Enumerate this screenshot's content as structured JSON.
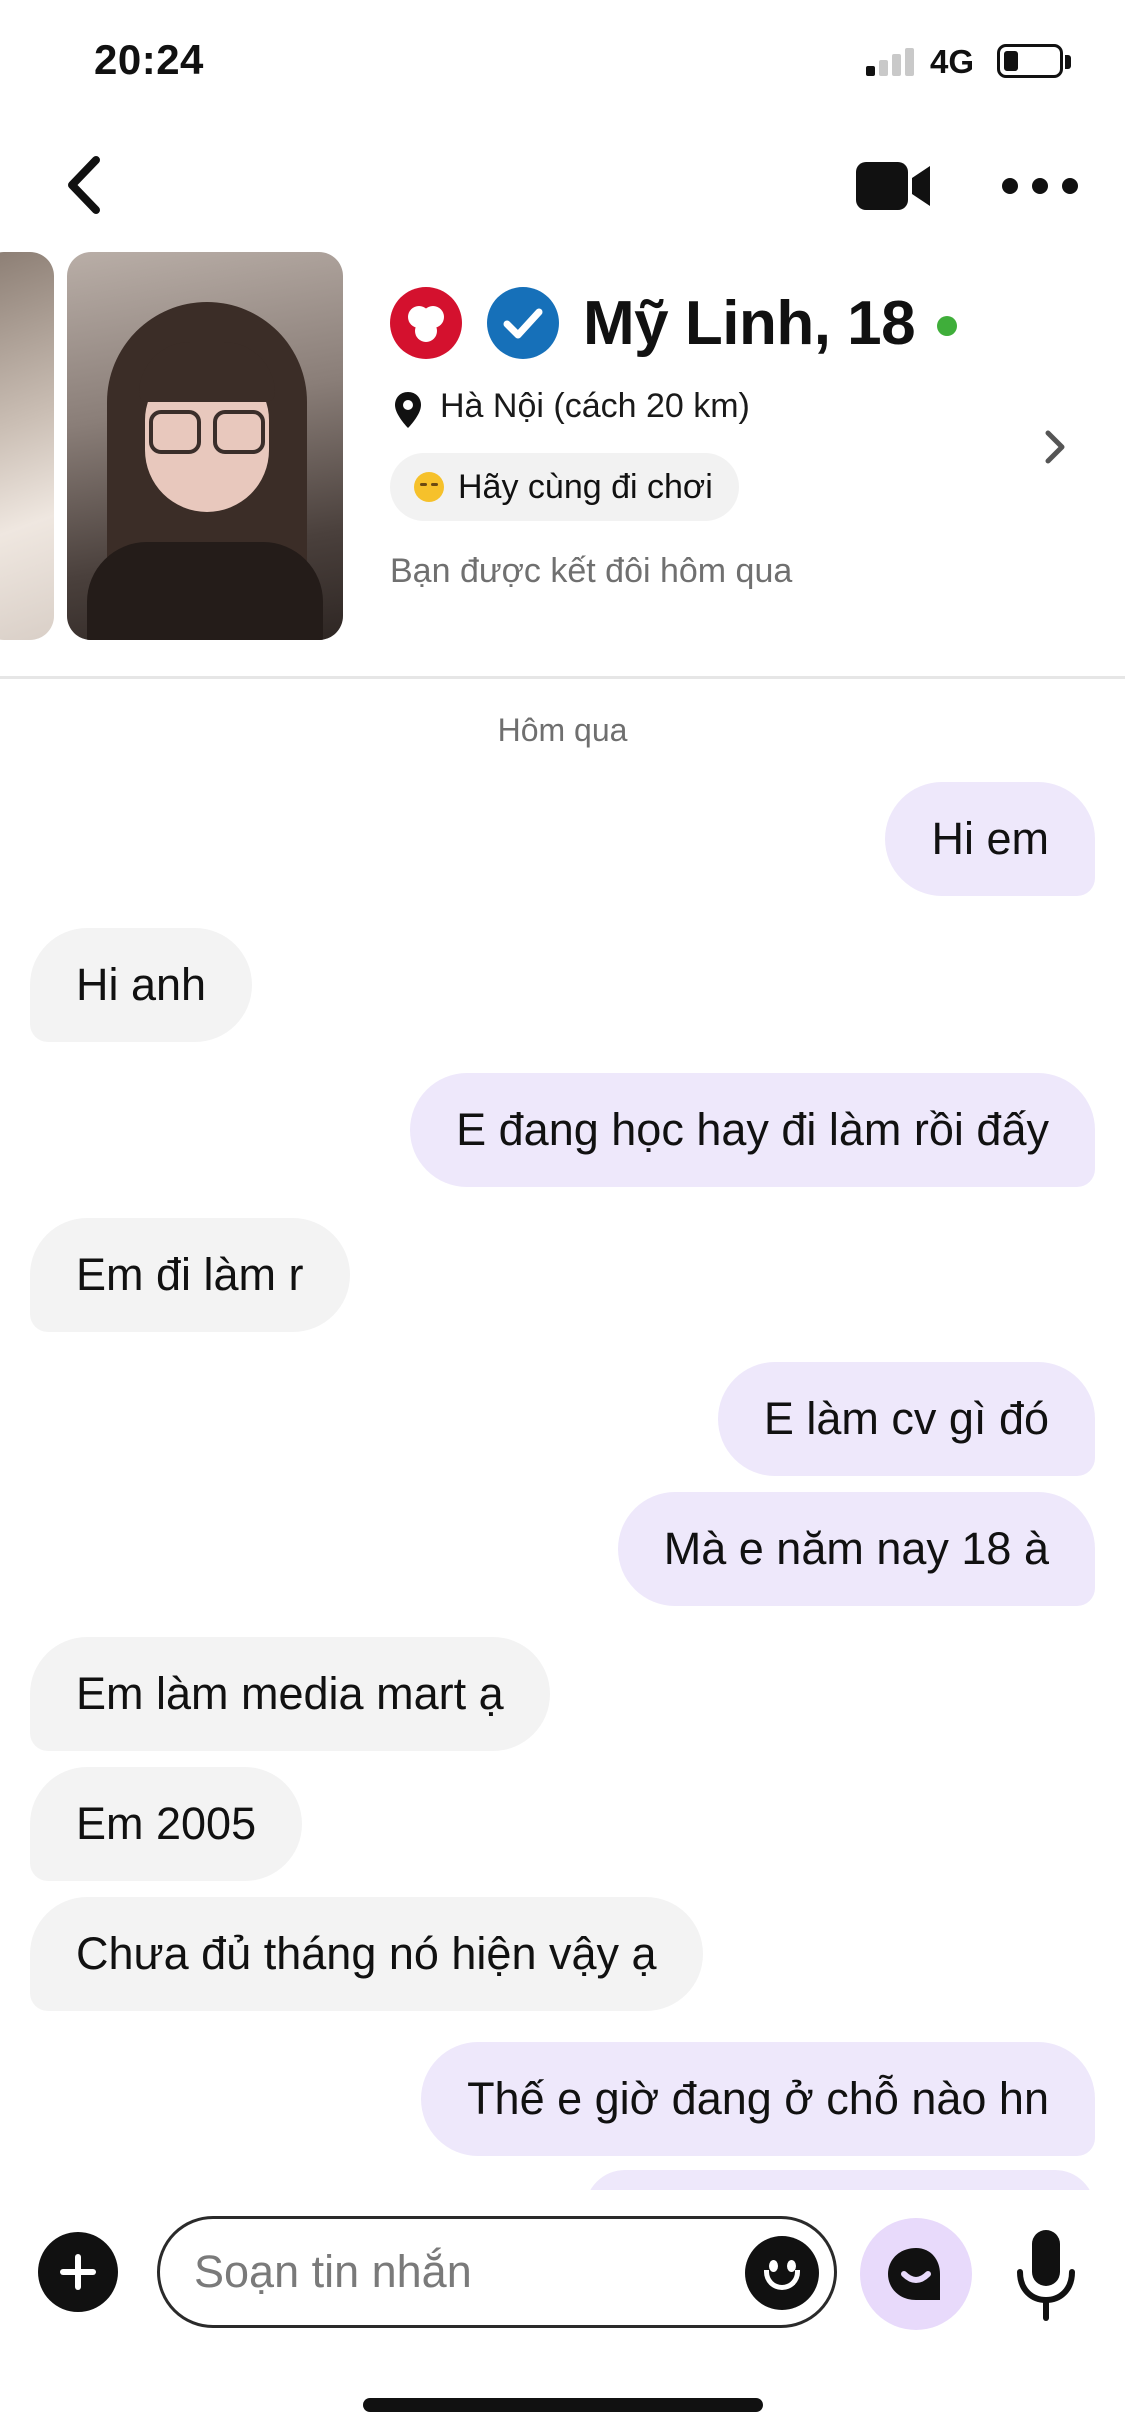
{
  "status_bar": {
    "time": "20:24",
    "network": "4G",
    "signal_bars_active": 1,
    "battery_level": 0.25
  },
  "nav": {
    "back_icon": "chevron-left-icon",
    "video_icon": "video-camera-icon",
    "more_icon": "more-horizontal-icon"
  },
  "profile": {
    "name": "Mỹ Linh, 18",
    "online": true,
    "location": "Hà Nội (cách 20 km)",
    "status_pill": "Hãy cùng đi chơi",
    "status_emoji": "relieved-face-emoji",
    "match_note": "Bạn được kết đôi hôm qua",
    "badges": [
      "bumble-badge-icon",
      "verified-badge-icon"
    ]
  },
  "chat": {
    "date_label": "Hôm qua",
    "messages": [
      {
        "from": "me",
        "text": "Hi em"
      },
      {
        "from": "them",
        "text": "Hi anh"
      },
      {
        "from": "me",
        "text": "E đang học hay đi làm rồi đấy"
      },
      {
        "from": "them",
        "text": "Em đi làm r"
      },
      {
        "from": "me",
        "text": "E làm cv gì đó"
      },
      {
        "from": "me",
        "text": "Mà e năm nay 18 à"
      },
      {
        "from": "them",
        "text": "Em làm media mart ạ"
      },
      {
        "from": "them",
        "text": "Em 2005"
      },
      {
        "from": "them",
        "text": "Chưa đủ tháng nó hiện vậy ạ"
      },
      {
        "from": "me",
        "text": "Thế e giờ đang ở chỗ nào hn"
      }
    ]
  },
  "composer": {
    "placeholder": "Soạn tin nhắn",
    "value": "",
    "add_icon": "plus-circle-icon",
    "emoji_icon": "smiley-icon",
    "gif_icon": "sticker-icon",
    "mic_icon": "microphone-icon"
  },
  "colors": {
    "outgoing_bubble": "#eee8fb",
    "incoming_bubble": "#f3f3f3",
    "online": "#3fae3a",
    "bumble_red": "#d4112e",
    "verified_blue": "#1670b9"
  }
}
